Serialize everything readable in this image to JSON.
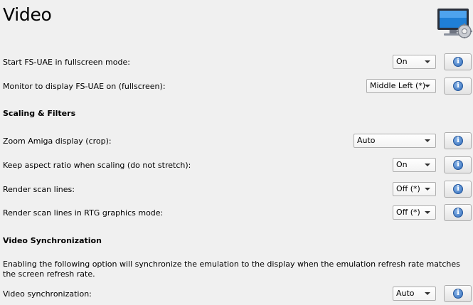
{
  "page": {
    "title": "Video"
  },
  "rows": {
    "fullscreen": {
      "label": "Start FS-UAE in fullscreen mode:",
      "value": "On"
    },
    "monitor": {
      "label": "Monitor to display FS-UAE on (fullscreen):",
      "value": "Middle Left (*)"
    },
    "zoom": {
      "label": "Zoom Amiga display (crop):",
      "value": "Auto"
    },
    "aspect": {
      "label": "Keep aspect ratio when scaling (do not stretch):",
      "value": "On"
    },
    "scanlines": {
      "label": "Render scan lines:",
      "value": "Off (*)"
    },
    "scanlines_rtg": {
      "label": "Render scan lines in RTG graphics mode:",
      "value": "Off (*)"
    },
    "vsync": {
      "label": "Video synchronization:",
      "value": "Auto"
    }
  },
  "sections": {
    "scaling": "Scaling & Filters",
    "sync": "Video Synchronization"
  },
  "sync_description": "Enabling the following option will synchronize the emulation to the display when the emulation refresh rate matches the screen refresh rate.",
  "icons": {
    "header": "monitor-settings-icon",
    "info": "info-icon"
  },
  "info_glyph": "i"
}
